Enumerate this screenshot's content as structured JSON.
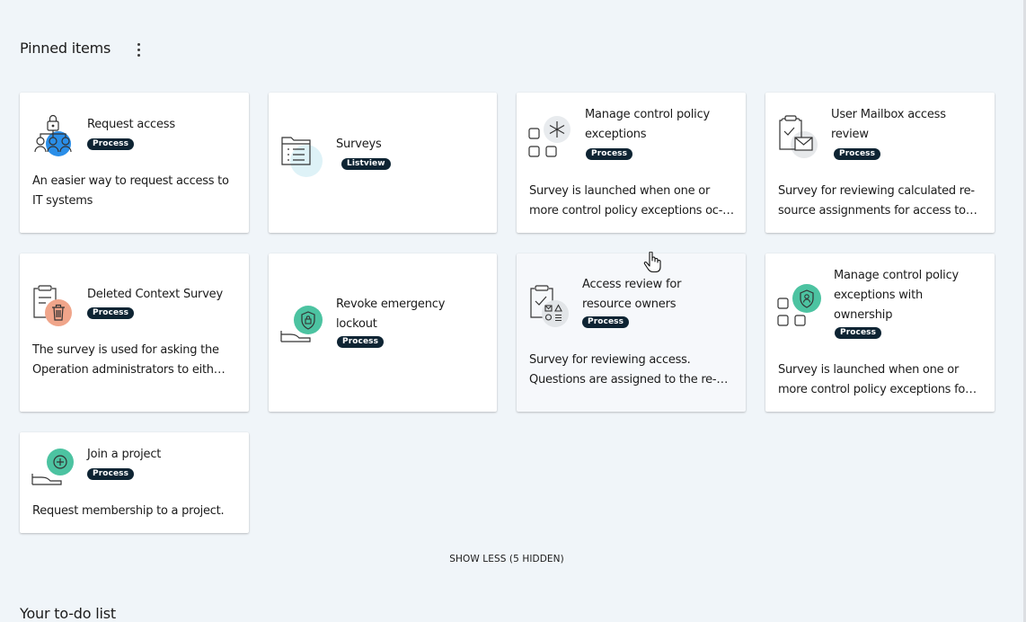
{
  "pinned": {
    "title": "Pinned items",
    "menu_icon": "more-vertical-icon"
  },
  "cards": [
    {
      "title": "Request access",
      "badge": "Process",
      "desc": [
        "An easier way to request access to",
        "IT systems"
      ],
      "icon": "request-access-icon"
    },
    {
      "title": "Surveys",
      "badge": "Listview",
      "desc": [],
      "icon": "surveys-list-icon"
    },
    {
      "title": "Manage control policy exceptions",
      "badge": "Process",
      "desc": [
        "Survey is launched when one or",
        "more control policy exceptions oc-…"
      ],
      "icon": "control-policy-icon"
    },
    {
      "title": "User Mailbox access review",
      "badge": "Process",
      "desc": [
        "Survey for reviewing calculated re-",
        "source assignments for access to…"
      ],
      "icon": "mailbox-review-icon"
    },
    {
      "title": "Deleted Context Survey",
      "badge": "Process",
      "desc": [
        "The survey is used for asking the",
        "Operation administrators to eith…"
      ],
      "icon": "deleted-survey-icon"
    },
    {
      "title": "Revoke emergency lockout",
      "badge": "Process",
      "desc": [],
      "icon": "emergency-lockout-icon"
    },
    {
      "title": "Access review for resource owners",
      "badge": "Process",
      "desc": [
        "Survey for reviewing access.",
        "Questions are assigned to the re-…"
      ],
      "icon": "resource-review-icon"
    },
    {
      "title": "Manage control policy exceptions with ownership",
      "badge": "Process",
      "desc": [
        "Survey is launched when one or",
        "more control policy exceptions fo…"
      ],
      "icon": "ownership-policy-icon"
    },
    {
      "title": "Join a project",
      "badge": "Process",
      "desc": [
        "Request membership to a project."
      ],
      "icon": "join-project-icon"
    }
  ],
  "show_less": "SHOW LESS (5 HIDDEN)",
  "todo": {
    "title": "Your to-do list"
  },
  "colors": {
    "badge_bg": "#0e2433",
    "blue_accent": "#2a8ee8",
    "teal_accent": "#4cc3a1",
    "orange_accent": "#f0a58a",
    "page_bg": "#f0f5f9"
  }
}
